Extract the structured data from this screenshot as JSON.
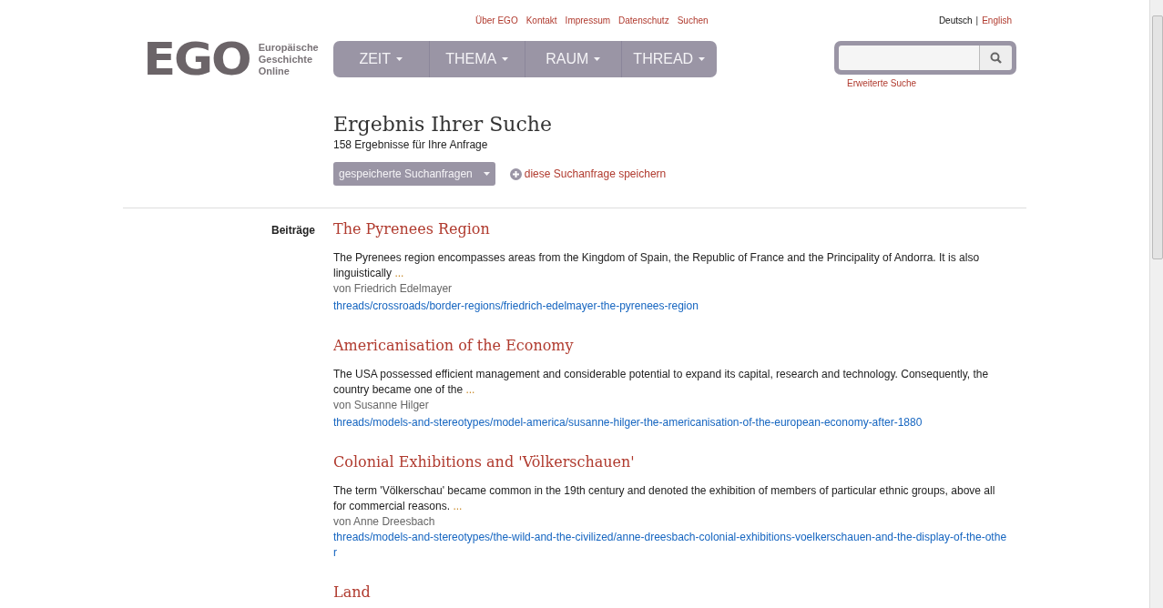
{
  "top_links": [
    "Über EGO",
    "Kontakt",
    "Impressum",
    "Datenschutz",
    "Suchen"
  ],
  "language_separator": "|",
  "languages": [
    {
      "label": "Deutsch",
      "selected": true
    },
    {
      "label": "English",
      "selected": false
    }
  ],
  "logo": {
    "mark": "EGO",
    "lines": [
      "Europäische",
      "Geschichte",
      "Online"
    ]
  },
  "nav": [
    "ZEIT",
    "THEMA",
    "RAUM",
    "THREAD"
  ],
  "search": {
    "advanced_link": "Erweiterte Suche"
  },
  "heading": "Ergebnis Ihrer Suche",
  "count": "158 Ergebnisse für Ihre Anfrage",
  "saved_dropdown": "gespeicherte Suchanfragen",
  "save_link": "diese Suchanfrage speichern",
  "section_label": "Beiträge",
  "results": [
    {
      "title": "The Pyrenees Region",
      "snippet": "The Pyrenees region encompasses areas from the Kingdom of Spain, the Republic of France and the Principality of Andorra. It is also linguistically",
      "more": "...",
      "author": "von Friedrich Edelmayer",
      "path": "threads/crossroads/border-regions/friedrich-edelmayer-the-pyrenees-region"
    },
    {
      "title": "Americanisation of the Economy",
      "snippet": "The USA possessed efficient management and considerable potential to expand its capital, research and technology. Consequently, the country became one of the",
      "more": "...",
      "author": "von Susanne Hilger",
      "path": "threads/models-and-stereotypes/model-america/susanne-hilger-the-americanisation-of-the-european-economy-after-1880"
    },
    {
      "title": "Colonial Exhibitions and 'Völkerschauen'",
      "snippet": "The term 'Völkerschau' became common in the 19th century and denoted the exhibition of members of particular ethnic groups, above all for commercial reasons.",
      "more": "...",
      "author": "von Anne Dreesbach",
      "path": "threads/models-and-stereotypes/the-wild-and-the-civilized/anne-dreesbach-colonial-exhibitions-voelkerschauen-and-the-display-of-the-other"
    },
    {
      "title": "Land"
    }
  ]
}
